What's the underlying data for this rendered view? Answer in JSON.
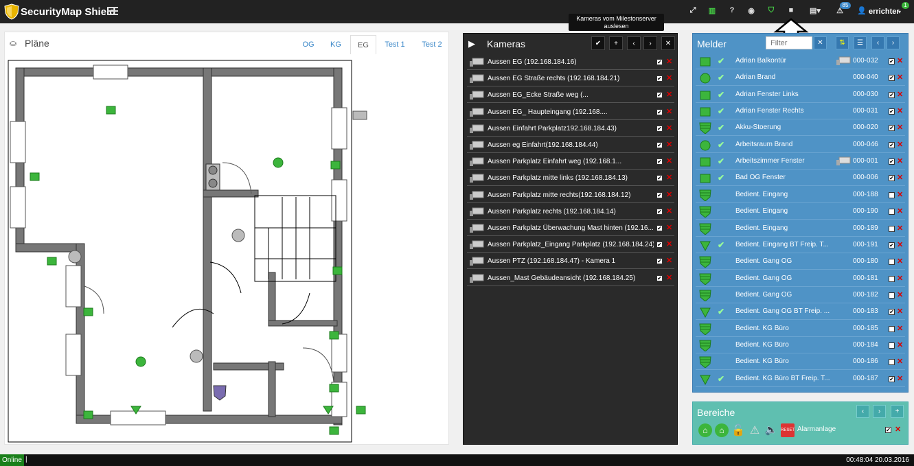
{
  "app": {
    "brand": "SecurityMap Shield",
    "user": "errichter",
    "alerts_badge": "85",
    "user_badge": "1"
  },
  "tooltip": "Kameras vom Milestonserver auslesen",
  "plans": {
    "title": "Pläne",
    "tabs": [
      "OG",
      "KG",
      "EG",
      "Test 1",
      "Test 2"
    ],
    "active_tab": "EG"
  },
  "cameras": {
    "title": "Kameras",
    "items": [
      {
        "label": "Aussen EG                          (192.168.184.16)",
        "enabled": true
      },
      {
        "label": "Aussen EG                    Straße rechts (192.168.184.21)",
        "enabled": true
      },
      {
        "label": "Aussen EG_Ecke                    Straße                    weg (...",
        "enabled": true
      },
      {
        "label": "Aussen EG_                        Haupteingang (192.168....",
        "enabled": true
      },
      {
        "label": "Aussen Einfahrt Parkplatz192.168.184.43)",
        "enabled": true
      },
      {
        "label": "Aussen                    eg Einfahrt(192.168.184.44)",
        "enabled": true
      },
      {
        "label": "Aussen Parkplatz Einfahrt                    weg (192.168.1...",
        "enabled": true
      },
      {
        "label": "Aussen Parkplatz mitte links (192.168.184.13)",
        "enabled": true
      },
      {
        "label": "Aussen Parkplatz mitte rechts(192.168.184.12)",
        "enabled": true
      },
      {
        "label": "Aussen Parkplatz rechts (192.168.184.14)",
        "enabled": true
      },
      {
        "label": "Aussen Parkplatz Überwachung Mast hinten (192.16...",
        "enabled": true
      },
      {
        "label": "Aussen Parkplatz_Eingang Parkplatz (192.168.184.24)",
        "enabled": true
      },
      {
        "label": "Aussen PTZ (192.168.184.47) - Kamera 1",
        "enabled": true
      },
      {
        "label": "Aussen_Mast Gebäudeansicht (192.168.184.25)",
        "enabled": true
      }
    ]
  },
  "melder": {
    "title": "Melder",
    "filter_placeholder": "Filter",
    "items": [
      {
        "label": "Adrian Balkontür",
        "num": "000-032",
        "icon": "window-icon",
        "ok": true,
        "cam": true,
        "checked": true
      },
      {
        "label": "Adrian Brand",
        "num": "000-040",
        "icon": "fire-icon",
        "ok": true,
        "cam": false,
        "checked": true
      },
      {
        "label": "Adrian Fenster Links",
        "num": "000-030",
        "icon": "window-icon",
        "ok": true,
        "cam": false,
        "checked": true
      },
      {
        "label": "Adrian Fenster Rechts",
        "num": "000-031",
        "icon": "window-icon",
        "ok": true,
        "cam": false,
        "checked": true
      },
      {
        "label": "Akku-Stoerung",
        "num": "000-020",
        "icon": "shield-icon",
        "ok": true,
        "cam": false,
        "checked": true
      },
      {
        "label": "Arbeitsraum Brand",
        "num": "000-046",
        "icon": "fire-icon",
        "ok": true,
        "cam": false,
        "checked": true
      },
      {
        "label": "Arbeitszimmer Fenster",
        "num": "000-001",
        "icon": "window-icon",
        "ok": true,
        "cam": true,
        "checked": true
      },
      {
        "label": "Bad OG Fenster",
        "num": "000-006",
        "icon": "window-icon",
        "ok": true,
        "cam": false,
        "checked": true
      },
      {
        "label": "Bedient. Eingang",
        "num": "000-188",
        "icon": "shield-icon",
        "ok": false,
        "cam": false,
        "checked": false
      },
      {
        "label": "Bedient. Eingang",
        "num": "000-190",
        "icon": "shield-icon",
        "ok": false,
        "cam": false,
        "checked": false
      },
      {
        "label": "Bedient. Eingang",
        "num": "000-189",
        "icon": "shield-icon",
        "ok": false,
        "cam": false,
        "checked": false
      },
      {
        "label": "Bedient. Eingang BT Freip. T...",
        "num": "000-191",
        "icon": "triangle-icon",
        "ok": true,
        "cam": false,
        "checked": true
      },
      {
        "label": "Bedient. Gang OG",
        "num": "000-180",
        "icon": "shield-icon",
        "ok": false,
        "cam": false,
        "checked": false
      },
      {
        "label": "Bedient. Gang OG",
        "num": "000-181",
        "icon": "shield-icon",
        "ok": false,
        "cam": false,
        "checked": false
      },
      {
        "label": "Bedient. Gang OG",
        "num": "000-182",
        "icon": "shield-icon",
        "ok": false,
        "cam": false,
        "checked": false
      },
      {
        "label": "Bedient. Gang OG BT Freip. ...",
        "num": "000-183",
        "icon": "triangle-icon",
        "ok": true,
        "cam": false,
        "checked": true
      },
      {
        "label": "Bedient. KG Büro",
        "num": "000-185",
        "icon": "shield-icon",
        "ok": false,
        "cam": false,
        "checked": false
      },
      {
        "label": "Bedient. KG Büro",
        "num": "000-184",
        "icon": "shield-icon",
        "ok": false,
        "cam": false,
        "checked": false
      },
      {
        "label": "Bedient. KG Büro",
        "num": "000-186",
        "icon": "shield-icon",
        "ok": false,
        "cam": false,
        "checked": false
      },
      {
        "label": "Bedient. KG Büro BT Freip. T...",
        "num": "000-187",
        "icon": "triangle-icon",
        "ok": true,
        "cam": false,
        "checked": true
      }
    ]
  },
  "bereiche": {
    "title": "Bereiche",
    "item": "Alarmanlage",
    "reset": "RESET"
  },
  "status": {
    "online": "Online",
    "cursor": "|",
    "datetime": "00:48:04 20.03.2016"
  },
  "colors": {
    "topbar": "#222222",
    "melder_bg": "#4f93c6",
    "bereiche_bg": "#5fbfb0",
    "cams_bg": "#2a2a2a",
    "green": "#3cb53c"
  }
}
